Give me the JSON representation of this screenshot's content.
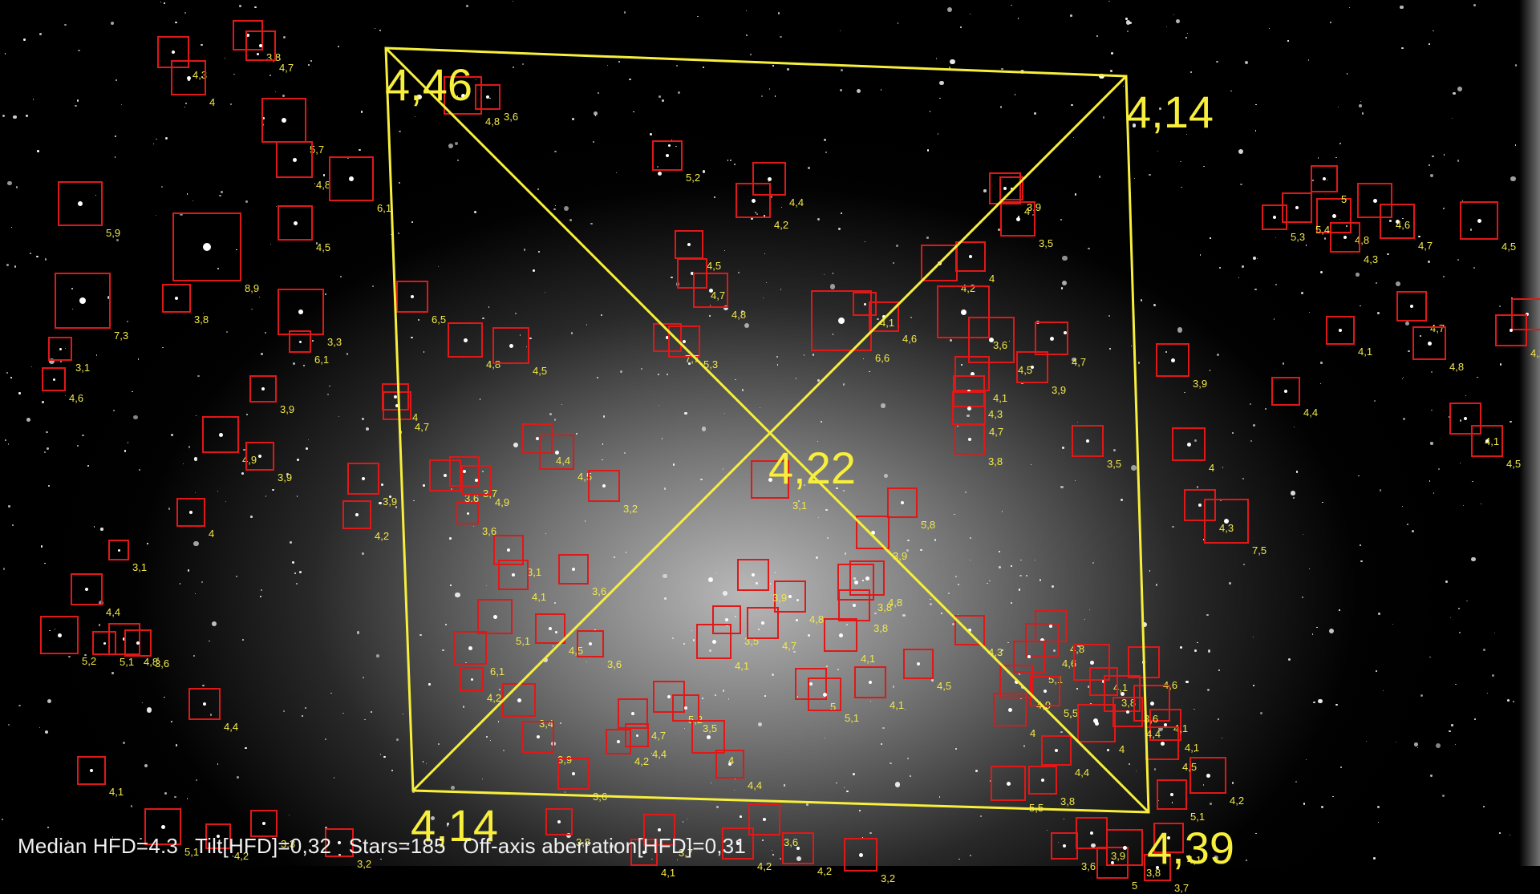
{
  "image": {
    "status": {
      "median_hfd": "Median HFD=4.3",
      "tilt": "Tilt[HFD]=0,32",
      "stars": "Stars=185",
      "off_axis": "Off-axis aberration[HFD]=0,31"
    },
    "tilt_corners": {
      "top_left": "4,46",
      "top_right": "4,14",
      "bottom_left": "4,14",
      "bottom_right": "4,39",
      "center": "4,22"
    },
    "overlay_color": "#f7ef3c",
    "box_color": "#e01818",
    "hfd_labels": [
      "4,3",
      "3,8",
      "4",
      "4,7",
      "5,7",
      "4,8",
      "6,1",
      "5,9",
      "8,9",
      "3,8",
      "7,3",
      "4,5",
      "3,3",
      "6,1",
      "3,1",
      "4,6",
      "3,9",
      "4,9",
      "3,9",
      "3,9",
      "4,2",
      "4",
      "3,1",
      "4,4",
      "5,2",
      "4,8",
      "3,6",
      "5,1",
      "4,4",
      "4,1",
      "5,1",
      "4,2",
      "3,3",
      "3,2",
      "4,8",
      "3,6",
      "6,5",
      "4",
      "4,7",
      "4,8",
      "4,5",
      "3,6",
      "3,7",
      "4,4",
      "4,5",
      "3,2",
      "4,9",
      "3,6",
      "3,1",
      "4,1",
      "3,6",
      "5,1",
      "4,5",
      "6,1",
      "4,2",
      "3,6",
      "4,7",
      "4,2",
      "3,4",
      "3,9",
      "5,2",
      "4,4",
      "3,6",
      "3,8",
      "3,7",
      "4,1",
      "4,2",
      "4,2",
      "3,6",
      "3,2",
      "4,4",
      "4",
      "3,5",
      "4,1",
      "3,5",
      "4,7",
      "5",
      "5,1",
      "4,8",
      "3,9",
      "3,1",
      "7,7",
      "5,3",
      "5,2",
      "4,4",
      "4,2",
      "4,5",
      "4,7",
      "4,8",
      "6,6",
      "4,1",
      "4,6",
      "4",
      "4",
      "3,9",
      "3,5",
      "4,2",
      "3,6",
      "4,5",
      "4,7",
      "4,1",
      "4,3",
      "4,7",
      "3,9",
      "3,8",
      "3,9",
      "3,8",
      "5,8",
      "4,8",
      "3,8",
      "4,1",
      "4,1",
      "4,5",
      "4,3",
      "4,8",
      "4,6",
      "5,1",
      "4,9",
      "4",
      "5,5",
      "4,1",
      "3,8",
      "4,6",
      "4,1",
      "5,1",
      "4,2",
      "4,1",
      "4,5",
      "3,6",
      "5,5",
      "4",
      "4,4",
      "4,4",
      "3,8",
      "3,9",
      "3,6",
      "5",
      "3,8",
      "4,1",
      "3,7",
      "3,9",
      "4",
      "4,3",
      "3,5",
      "7,5",
      "4,4",
      "4,8",
      "4,7",
      "4,5",
      "4,3",
      "4,6",
      "5,3",
      "5,4",
      "5",
      "4,3",
      "4,7",
      "4,2",
      "4,8",
      "4,1",
      "4,5",
      "4,1"
    ]
  }
}
